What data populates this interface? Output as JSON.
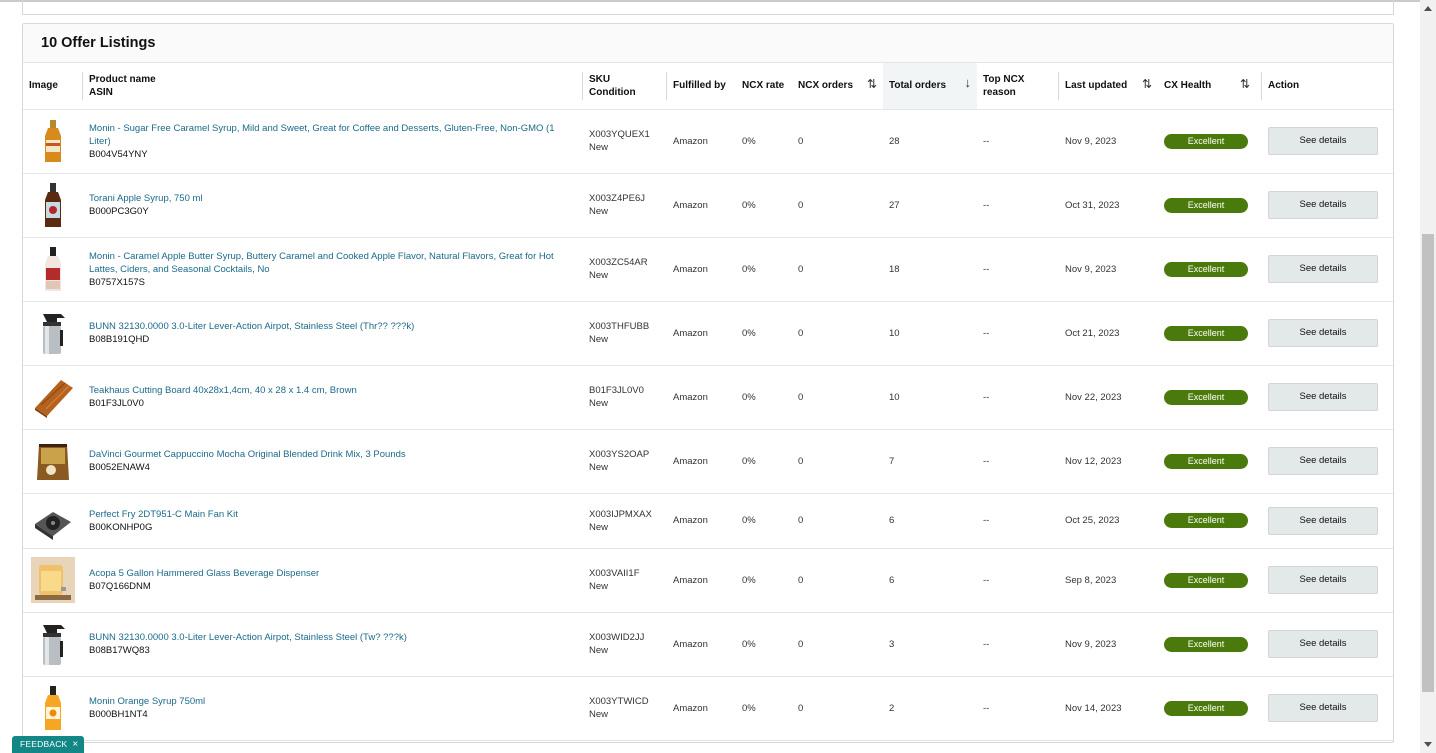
{
  "card": {
    "title": "10 Offer Listings"
  },
  "columns": {
    "image": "Image",
    "product_name": "Product name",
    "asin": "ASIN",
    "sku": "SKU",
    "condition": "Condition",
    "fulfilled_by": "Fulfilled by",
    "ncx_rate": "NCX rate",
    "ncx_orders": "NCX orders",
    "total_orders": "Total orders",
    "top_ncx_reason_1": "Top NCX",
    "top_ncx_reason_2": "reason",
    "last_updated": "Last updated",
    "cx_health": "CX Health",
    "action": "Action"
  },
  "rows": [
    {
      "name": "Monin - Sugar Free Caramel Syrup, Mild and Sweet, Great for Coffee and Desserts, Gluten-Free, Non-GMO (1 Liter)",
      "asin": "B004V54YNY",
      "sku": "X003YQUEX1",
      "condition": "New",
      "fulfilled_by": "Amazon",
      "ncx_rate": "0%",
      "ncx_orders": "0",
      "total_orders": "28",
      "top_ncx_reason": "--",
      "last_updated": "Nov 9, 2023",
      "cx_health": "Excellent",
      "action": "See details",
      "image_icon": "syrup-bottle-amber-icon"
    },
    {
      "name": "Torani Apple Syrup, 750 ml",
      "asin": "B000PC3G0Y",
      "sku": "X003Z4PE6J",
      "condition": "New",
      "fulfilled_by": "Amazon",
      "ncx_rate": "0%",
      "ncx_orders": "0",
      "total_orders": "27",
      "top_ncx_reason": "--",
      "last_updated": "Oct 31, 2023",
      "cx_health": "Excellent",
      "action": "See details",
      "image_icon": "syrup-bottle-dark-icon"
    },
    {
      "name": "Monin - Caramel Apple Butter Syrup, Buttery Caramel and Cooked Apple Flavor, Natural Flavors, Great for Hot Lattes, Ciders, and Seasonal Cocktails, No",
      "asin": "B0757X157S",
      "sku": "X003ZC54AR",
      "condition": "New",
      "fulfilled_by": "Amazon",
      "ncx_rate": "0%",
      "ncx_orders": "0",
      "total_orders": "18",
      "top_ncx_reason": "--",
      "last_updated": "Nov 9, 2023",
      "cx_health": "Excellent",
      "action": "See details",
      "image_icon": "syrup-bottle-red-icon"
    },
    {
      "name": "BUNN 32130.0000 3.0-Liter Lever-Action Airpot, Stainless Steel (Thr?? ???k)",
      "asin": "B08B191QHD",
      "sku": "X003THFUBB",
      "condition": "New",
      "fulfilled_by": "Amazon",
      "ncx_rate": "0%",
      "ncx_orders": "0",
      "total_orders": "10",
      "top_ncx_reason": "--",
      "last_updated": "Oct 21, 2023",
      "cx_health": "Excellent",
      "action": "See details",
      "image_icon": "airpot-icon"
    },
    {
      "name": "Teakhaus Cutting Board 40x28x1,4cm, 40 x 28 x 1.4 cm, Brown",
      "asin": "B01F3JL0V0",
      "sku": "B01F3JL0V0",
      "condition": "New",
      "fulfilled_by": "Amazon",
      "ncx_rate": "0%",
      "ncx_orders": "0",
      "total_orders": "10",
      "top_ncx_reason": "--",
      "last_updated": "Nov 22, 2023",
      "cx_health": "Excellent",
      "action": "See details",
      "image_icon": "cutting-board-icon"
    },
    {
      "name": "DaVinci Gourmet Cappuccino Mocha Original Blended Drink Mix, 3 Pounds",
      "asin": "B0052ENAW4",
      "sku": "X003YS2OAP",
      "condition": "New",
      "fulfilled_by": "Amazon",
      "ncx_rate": "0%",
      "ncx_orders": "0",
      "total_orders": "7",
      "top_ncx_reason": "--",
      "last_updated": "Nov 12, 2023",
      "cx_health": "Excellent",
      "action": "See details",
      "image_icon": "drink-mix-bag-icon"
    },
    {
      "name": "Perfect Fry 2DT951-C Main Fan Kit",
      "asin": "B00KONHP0G",
      "sku": "X003IJPMXAX",
      "condition": "New",
      "fulfilled_by": "Amazon",
      "ncx_rate": "0%",
      "ncx_orders": "0",
      "total_orders": "6",
      "top_ncx_reason": "--",
      "last_updated": "Oct 25, 2023",
      "cx_health": "Excellent",
      "action": "See details",
      "image_icon": "fan-kit-icon"
    },
    {
      "name": "Acopa 5 Gallon Hammered Glass Beverage Dispenser",
      "asin": "B07Q166DNM",
      "sku": "X003VAII1F",
      "condition": "New",
      "fulfilled_by": "Amazon",
      "ncx_rate": "0%",
      "ncx_orders": "0",
      "total_orders": "6",
      "top_ncx_reason": "--",
      "last_updated": "Sep 8, 2023",
      "cx_health": "Excellent",
      "action": "See details",
      "image_icon": "beverage-dispenser-icon"
    },
    {
      "name": "BUNN 32130.0000 3.0-Liter Lever-Action Airpot, Stainless Steel (Tw? ???k)",
      "asin": "B08B17WQ83",
      "sku": "X003WID2JJ",
      "condition": "New",
      "fulfilled_by": "Amazon",
      "ncx_rate": "0%",
      "ncx_orders": "0",
      "total_orders": "3",
      "top_ncx_reason": "--",
      "last_updated": "Nov 9, 2023",
      "cx_health": "Excellent",
      "action": "See details",
      "image_icon": "airpot-icon"
    },
    {
      "name": "Monin Orange Syrup 750ml",
      "asin": "B000BH1NT4",
      "sku": "X003YTWICD",
      "condition": "New",
      "fulfilled_by": "Amazon",
      "ncx_rate": "0%",
      "ncx_orders": "0",
      "total_orders": "2",
      "top_ncx_reason": "--",
      "last_updated": "Nov 14, 2023",
      "cx_health": "Excellent",
      "action": "See details",
      "image_icon": "syrup-bottle-orange-icon"
    }
  ],
  "colors": {
    "link": "#1b6a8a",
    "badge": "#4a7a0b",
    "feedback": "#138686"
  },
  "feedback": {
    "label": "FEEDBACK",
    "close": "×"
  }
}
